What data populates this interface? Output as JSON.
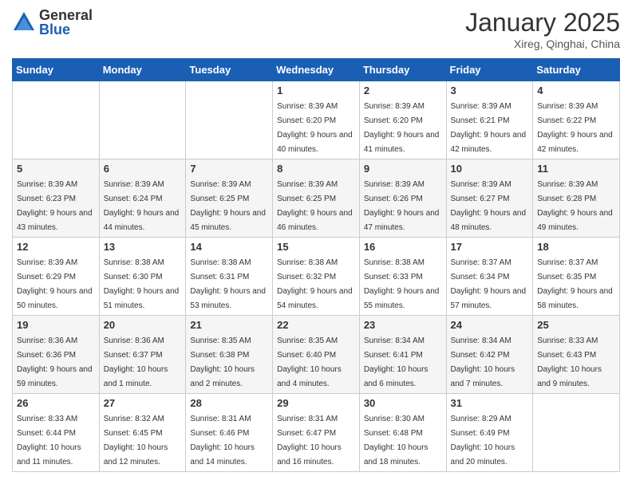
{
  "logo": {
    "general": "General",
    "blue": "Blue"
  },
  "title": "January 2025",
  "location": "Xireg, Qinghai, China",
  "days_header": [
    "Sunday",
    "Monday",
    "Tuesday",
    "Wednesday",
    "Thursday",
    "Friday",
    "Saturday"
  ],
  "weeks": [
    [
      {
        "day": "",
        "info": ""
      },
      {
        "day": "",
        "info": ""
      },
      {
        "day": "",
        "info": ""
      },
      {
        "day": "1",
        "info": "Sunrise: 8:39 AM\nSunset: 6:20 PM\nDaylight: 9 hours and 40 minutes."
      },
      {
        "day": "2",
        "info": "Sunrise: 8:39 AM\nSunset: 6:20 PM\nDaylight: 9 hours and 41 minutes."
      },
      {
        "day": "3",
        "info": "Sunrise: 8:39 AM\nSunset: 6:21 PM\nDaylight: 9 hours and 42 minutes."
      },
      {
        "day": "4",
        "info": "Sunrise: 8:39 AM\nSunset: 6:22 PM\nDaylight: 9 hours and 42 minutes."
      }
    ],
    [
      {
        "day": "5",
        "info": "Sunrise: 8:39 AM\nSunset: 6:23 PM\nDaylight: 9 hours and 43 minutes."
      },
      {
        "day": "6",
        "info": "Sunrise: 8:39 AM\nSunset: 6:24 PM\nDaylight: 9 hours and 44 minutes."
      },
      {
        "day": "7",
        "info": "Sunrise: 8:39 AM\nSunset: 6:25 PM\nDaylight: 9 hours and 45 minutes."
      },
      {
        "day": "8",
        "info": "Sunrise: 8:39 AM\nSunset: 6:25 PM\nDaylight: 9 hours and 46 minutes."
      },
      {
        "day": "9",
        "info": "Sunrise: 8:39 AM\nSunset: 6:26 PM\nDaylight: 9 hours and 47 minutes."
      },
      {
        "day": "10",
        "info": "Sunrise: 8:39 AM\nSunset: 6:27 PM\nDaylight: 9 hours and 48 minutes."
      },
      {
        "day": "11",
        "info": "Sunrise: 8:39 AM\nSunset: 6:28 PM\nDaylight: 9 hours and 49 minutes."
      }
    ],
    [
      {
        "day": "12",
        "info": "Sunrise: 8:39 AM\nSunset: 6:29 PM\nDaylight: 9 hours and 50 minutes."
      },
      {
        "day": "13",
        "info": "Sunrise: 8:38 AM\nSunset: 6:30 PM\nDaylight: 9 hours and 51 minutes."
      },
      {
        "day": "14",
        "info": "Sunrise: 8:38 AM\nSunset: 6:31 PM\nDaylight: 9 hours and 53 minutes."
      },
      {
        "day": "15",
        "info": "Sunrise: 8:38 AM\nSunset: 6:32 PM\nDaylight: 9 hours and 54 minutes."
      },
      {
        "day": "16",
        "info": "Sunrise: 8:38 AM\nSunset: 6:33 PM\nDaylight: 9 hours and 55 minutes."
      },
      {
        "day": "17",
        "info": "Sunrise: 8:37 AM\nSunset: 6:34 PM\nDaylight: 9 hours and 57 minutes."
      },
      {
        "day": "18",
        "info": "Sunrise: 8:37 AM\nSunset: 6:35 PM\nDaylight: 9 hours and 58 minutes."
      }
    ],
    [
      {
        "day": "19",
        "info": "Sunrise: 8:36 AM\nSunset: 6:36 PM\nDaylight: 9 hours and 59 minutes."
      },
      {
        "day": "20",
        "info": "Sunrise: 8:36 AM\nSunset: 6:37 PM\nDaylight: 10 hours and 1 minute."
      },
      {
        "day": "21",
        "info": "Sunrise: 8:35 AM\nSunset: 6:38 PM\nDaylight: 10 hours and 2 minutes."
      },
      {
        "day": "22",
        "info": "Sunrise: 8:35 AM\nSunset: 6:40 PM\nDaylight: 10 hours and 4 minutes."
      },
      {
        "day": "23",
        "info": "Sunrise: 8:34 AM\nSunset: 6:41 PM\nDaylight: 10 hours and 6 minutes."
      },
      {
        "day": "24",
        "info": "Sunrise: 8:34 AM\nSunset: 6:42 PM\nDaylight: 10 hours and 7 minutes."
      },
      {
        "day": "25",
        "info": "Sunrise: 8:33 AM\nSunset: 6:43 PM\nDaylight: 10 hours and 9 minutes."
      }
    ],
    [
      {
        "day": "26",
        "info": "Sunrise: 8:33 AM\nSunset: 6:44 PM\nDaylight: 10 hours and 11 minutes."
      },
      {
        "day": "27",
        "info": "Sunrise: 8:32 AM\nSunset: 6:45 PM\nDaylight: 10 hours and 12 minutes."
      },
      {
        "day": "28",
        "info": "Sunrise: 8:31 AM\nSunset: 6:46 PM\nDaylight: 10 hours and 14 minutes."
      },
      {
        "day": "29",
        "info": "Sunrise: 8:31 AM\nSunset: 6:47 PM\nDaylight: 10 hours and 16 minutes."
      },
      {
        "day": "30",
        "info": "Sunrise: 8:30 AM\nSunset: 6:48 PM\nDaylight: 10 hours and 18 minutes."
      },
      {
        "day": "31",
        "info": "Sunrise: 8:29 AM\nSunset: 6:49 PM\nDaylight: 10 hours and 20 minutes."
      },
      {
        "day": "",
        "info": ""
      }
    ]
  ]
}
